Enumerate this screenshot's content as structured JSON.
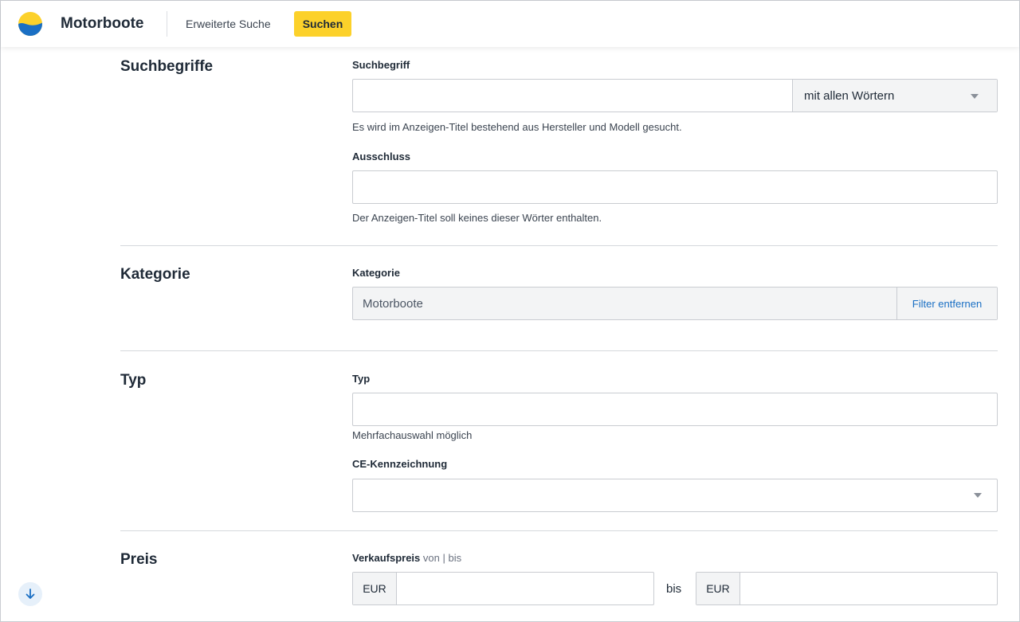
{
  "header": {
    "title": "Motorboote",
    "nav_link": "Erweiterte Suche",
    "search_button": "Suchen"
  },
  "sections": {
    "suchbegriffe": {
      "title": "Suchbegriffe",
      "search_label": "Suchbegriff",
      "search_value": "",
      "match_mode": "mit allen Wörtern",
      "search_hint": "Es wird im Anzeigen-Titel bestehend aus Hersteller und Modell gesucht.",
      "exclude_label": "Ausschluss",
      "exclude_value": "",
      "exclude_hint": "Der Anzeigen-Titel soll keines dieser Wörter enthalten."
    },
    "kategorie": {
      "title": "Kategorie",
      "label": "Kategorie",
      "value": "Motorboote",
      "remove_filter": "Filter entfernen"
    },
    "typ": {
      "title": "Typ",
      "type_label": "Typ",
      "type_value": "",
      "type_hint": "Mehrfachauswahl möglich",
      "ce_label": "CE-Kennzeichnung",
      "ce_value": ""
    },
    "preis": {
      "title": "Preis",
      "label": "Verkaufspreis",
      "label_sub": "von | bis",
      "currency_from": "EUR",
      "currency_to": "EUR",
      "between": "bis",
      "from_value": "",
      "to_value": ""
    }
  },
  "colors": {
    "accent": "#fcd12a",
    "link": "#1a6fc4",
    "logo_top": "#fcd12a",
    "logo_bottom": "#1a6fc4"
  },
  "icons": {
    "logo": "wave-logo-icon",
    "scroll": "arrow-down-icon",
    "dropdown": "chevron-down-icon"
  }
}
